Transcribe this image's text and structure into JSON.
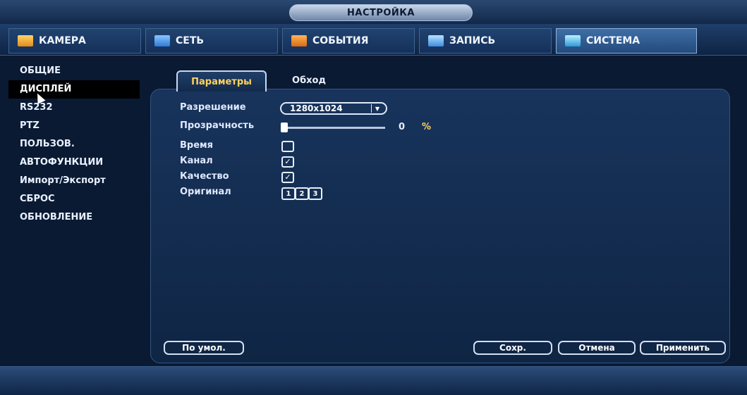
{
  "window": {
    "title": "НАСТРОЙКА"
  },
  "tabs": [
    {
      "label": "КАМЕРА",
      "icon": "camera-icon"
    },
    {
      "label": "СЕТЬ",
      "icon": "network-icon"
    },
    {
      "label": "СОБЫТИЯ",
      "icon": "events-icon"
    },
    {
      "label": "ЗАПИСЬ",
      "icon": "record-icon"
    },
    {
      "label": "СИСТЕМА",
      "icon": "system-icon",
      "active": true
    }
  ],
  "sidebar": {
    "items": [
      {
        "label": "ОБЩИЕ"
      },
      {
        "label": "ДИСПЛЕЙ",
        "active": true
      },
      {
        "label": "RS232"
      },
      {
        "label": "PTZ"
      },
      {
        "label": "ПОЛЬЗОВ."
      },
      {
        "label": "АВТОФУНКЦИИ"
      },
      {
        "label": "Импорт/Экспорт"
      },
      {
        "label": "СБРОС"
      },
      {
        "label": "ОБНОВЛЕНИЕ"
      }
    ]
  },
  "subtabs": {
    "params": "Параметры",
    "tour": "Обход"
  },
  "form": {
    "resolution": {
      "label": "Разрешение",
      "value": "1280x1024"
    },
    "transparency": {
      "label": "Прозрачность",
      "value": "0",
      "unit": "%",
      "fraction": 0
    },
    "time": {
      "label": "Время",
      "checked": false
    },
    "channel": {
      "label": "Канал",
      "checked": true
    },
    "quality": {
      "label": "Качество",
      "checked": true
    },
    "original": {
      "label": "Оригинал",
      "options": [
        "1",
        "2",
        "3"
      ]
    }
  },
  "buttons": {
    "default": "По умол.",
    "save": "Сохр.",
    "cancel": "Отмена",
    "apply": "Применить"
  }
}
